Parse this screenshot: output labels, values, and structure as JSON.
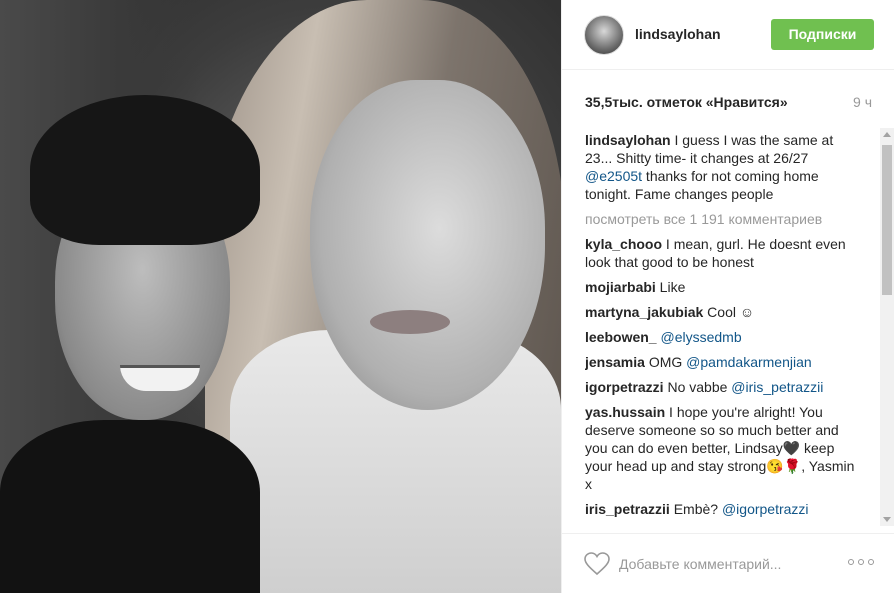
{
  "post": {
    "username": "lindsaylohan",
    "follow_label": "Подписки",
    "likes_text": "35,5тыс. отметок «Нравится»",
    "time_ago": "9 ч"
  },
  "caption": {
    "username": "lindsaylohan",
    "text_before": " I guess I was the same at 23... Shitty time- it changes at 26/27 ",
    "mention": "@e2505t",
    "text_after": " thanks for not coming home tonight. Fame changes people"
  },
  "view_all_comments": "посмотреть все 1 191 комментариев",
  "comments": [
    {
      "username": "kyla_chooo",
      "text": " I mean, gurl. He doesnt even look that good to be honest",
      "mention": ""
    },
    {
      "username": "mojiarbabi",
      "text": " Like",
      "mention": ""
    },
    {
      "username": "martyna_jakubiak",
      "text": " Cool ☺",
      "mention": ""
    },
    {
      "username": "leebowen_",
      "text": " ",
      "mention": "@elyssedmb"
    },
    {
      "username": "jensamia",
      "text": " OMG ",
      "mention": "@pamdakarmenjian"
    },
    {
      "username": "igorpetrazzi",
      "text": " No vabbe ",
      "mention": "@iris_petrazzii"
    },
    {
      "username": "yas.hussain",
      "text": " I hope you're alright! You deserve someone so so much better and you can do even better, Lindsay🖤 keep your head up and stay strong😘🌹, Yasmin x",
      "mention": ""
    },
    {
      "username": "iris_petrazzii",
      "text": " Embè? ",
      "mention": "@igorpetrazzi"
    }
  ],
  "footer": {
    "comment_placeholder": "Добавьте комментарий...",
    "heart_icon": "heart-outline-icon",
    "more_icon": "more-options-icon"
  },
  "colors": {
    "follow_button": "#70c050",
    "mention": "#125688",
    "muted": "#999999"
  }
}
